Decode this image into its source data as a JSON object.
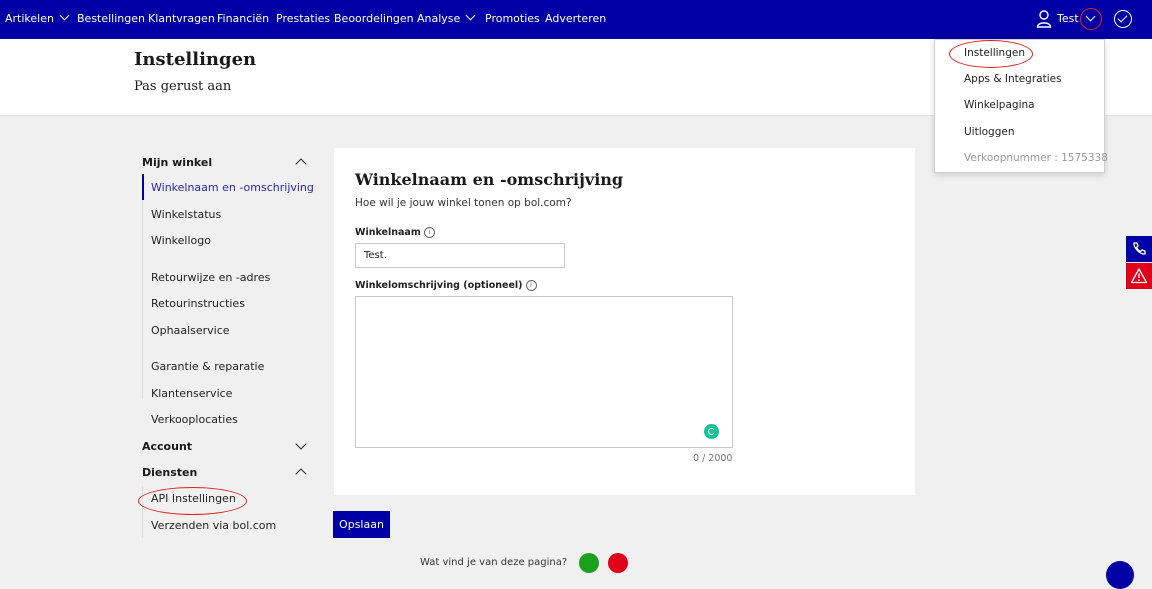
{
  "nav": {
    "items": [
      "Artikelen",
      "Bestellingen",
      "Klantvragen",
      "Financiën",
      "Prestaties",
      "Beoordelingen",
      "Analyse",
      "Promoties",
      "Adverteren"
    ],
    "user_name": "Test"
  },
  "header": {
    "title": "Instellingen",
    "subtitle": "Pas gerust aan"
  },
  "user_menu": {
    "items": [
      "Instellingen",
      "Apps & Integraties",
      "Winkelpagina",
      "Uitloggen"
    ],
    "seller_number": "Verkoopnummer : 1575338"
  },
  "sidebar": {
    "mijn_winkel": {
      "title": "Mijn winkel",
      "items": [
        "Winkelnaam en -omschrijving",
        "Winkelstatus",
        "Winkellogo",
        "Retourwijze en -adres",
        "Retourinstructies",
        "Ophaalservice",
        "Garantie & reparatie",
        "Klantenservice",
        "Verkooplocaties"
      ]
    },
    "account": {
      "title": "Account"
    },
    "diensten": {
      "title": "Diensten",
      "items": [
        "API Instellingen",
        "Verzenden via bol.com"
      ]
    }
  },
  "form": {
    "title": "Winkelnaam en -omschrijving",
    "subtitle": "Hoe wil je jouw winkel tonen op bol.com?",
    "name_label": "Winkelnaam",
    "name_value": "Test.",
    "description_label": "Winkelomschrijving (optioneel)",
    "description_value": "",
    "counter": "0 / 2000"
  },
  "save_label": "Opslaan",
  "feedback_question": "Wat vind je van deze pagina?",
  "icons": {
    "user": "user-icon",
    "dropdown": "chevron-down-icon",
    "check": "check-circle-icon",
    "info": "info-icon",
    "grammarly": "grammarly-icon",
    "phone": "phone-icon",
    "warning": "warning-icon"
  },
  "colors": {
    "brand": "#0000a4",
    "annotation": "#e02020",
    "positive": "#1ca01c",
    "negative": "#e0001a"
  }
}
